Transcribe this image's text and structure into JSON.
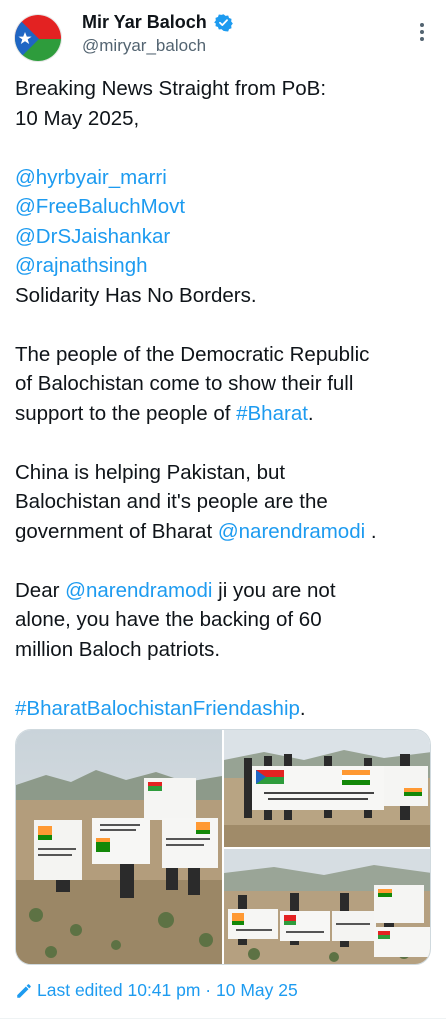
{
  "author": {
    "display_name": "Mir Yar Baloch",
    "handle": "@miryar_baloch",
    "verified": true,
    "accent_color": "#1d9bf0"
  },
  "tweet": {
    "line1": "Breaking News Straight from PoB:",
    "line2": "10 May 2025,",
    "mentions": [
      "@hyrbyair_marri",
      "@FreeBaluchMovt",
      "@DrSJaishankar",
      "@rajnathsingh"
    ],
    "solidarity": "Solidarity Has No Borders.",
    "para2_a": "The people of the Democratic Republic",
    "para2_b": "of Balochistan come to show their full",
    "para2_c": "support to the people of ",
    "para2_hashtag": "#Bharat",
    "para2_end": ".",
    "para3_a": "China is helping Pakistan, but",
    "para3_b": "Balochistan and it's people are the",
    "para3_c": "government of Bharat ",
    "para3_mention": "@narendramodi",
    "para3_end": " .",
    "para4_a": "Dear ",
    "para4_mention": "@narendramodi",
    "para4_b": " ji you are not",
    "para4_c": "alone, you have the backing of 60",
    "para4_d": "million Baloch patriots.",
    "hashtag_final": "#BharatBalochistanFriendaship",
    "hashtag_final_end": "."
  },
  "media": {
    "photo_count": 3,
    "banner_texts": [
      "Pro Justice, Peace, and Dignity",
      "Together For Peace, United For Progress",
      "Solidarity Has No Borders Baloch and Indian Together",
      "Baloch and Indian friendship is the only weapon that will fear, damage and destroy the DEVIL - PAKISTAN"
    ]
  },
  "footer": {
    "edited_label": "Last edited 10:41 pm · 10 May 25"
  },
  "icons": {
    "more": "more-vertical-icon",
    "verified": "verified-badge-icon",
    "edit": "pencil-icon"
  }
}
